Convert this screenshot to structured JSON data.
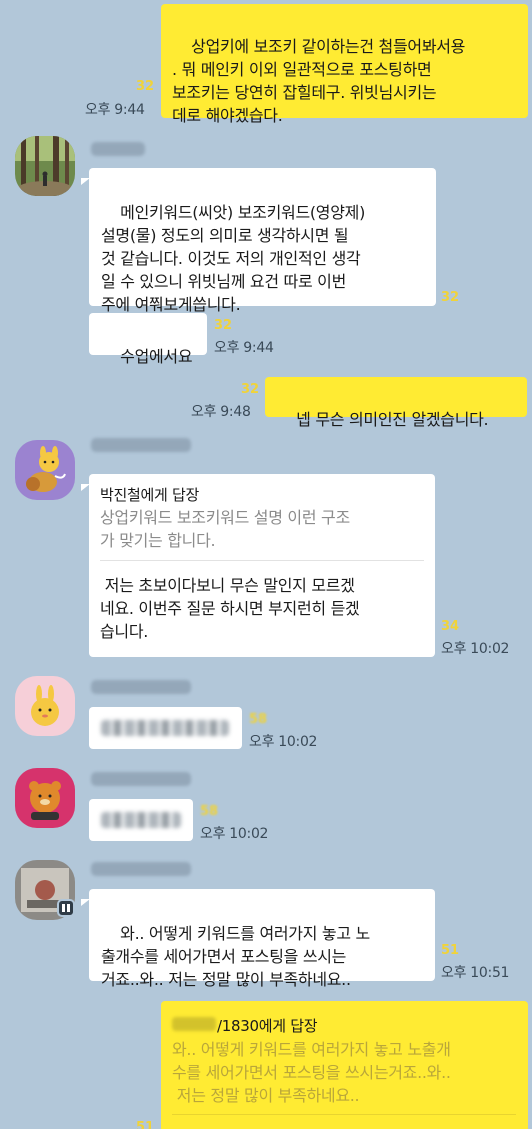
{
  "messages": {
    "m1": {
      "text": "상업키에 보조키 같이하는건 첨들어봐서용\n. 뭐 메인키 이외 일관적으로 포스팅하면\n보조키는 당연히 잡힐테구. 위빗님시키는\n데로 해야겠습다.",
      "unread": "32",
      "time": "오후 9:44"
    },
    "m2": {
      "text": "메인키워드(씨앗) 보조키워드(영양제)\n설명(물) 정도의 의미로 생각하시면 될\n것 같습니다. 이것도 저의 개인적인 생각\n일 수 있으니 위빗님께 요건 따로 이번\n주에 여쭤보게씁니다.",
      "unread": "32"
    },
    "m3": {
      "text": "수업에서요",
      "unread": "32",
      "time": "오후 9:44"
    },
    "m4": {
      "text": "넵 무슨 의미인진 알겠습니다.",
      "unread": "32",
      "time": "오후 9:48"
    },
    "m5": {
      "reply_to": "박진철에게 답장",
      "quote": "상업키워드 보조키워드 설명 이런 구조\n가 맞기는 합니다.",
      "text": " 저는 초보이다보니 무슨 말인지 모르겠\n네요. 이번주 질문 하시면 부지런히 듣겠\n습니다.",
      "unread": "34",
      "time": "오후 10:02"
    },
    "m6": {
      "unread": "58",
      "time": "오후 10:02"
    },
    "m7": {
      "unread": "58",
      "time": "오후 10:02"
    },
    "m8": {
      "text": "와.. 어떻게 키워드를 여러가지 놓고 노\n출개수를 세어가면서 포스팅을 쓰시는\n거죠..와.. 저는 정말 많이 부족하네요..",
      "unread": "51",
      "time": "오후 10:51"
    },
    "m9": {
      "reply_to": "/1830에게 답장",
      "quote": "와.. 어떻게 키워드를 여러가지 놓고 노출개\n수를 세어가면서 포스팅을 쓰시는거죠..와..\n 저는 정말 많이 부족하네요..",
      "unread": "51"
    }
  },
  "colors": {
    "background": "#b2c7d9",
    "my_bubble": "#ffeb33",
    "their_bubble": "#ffffff",
    "unread_count": "#f0d33a"
  }
}
